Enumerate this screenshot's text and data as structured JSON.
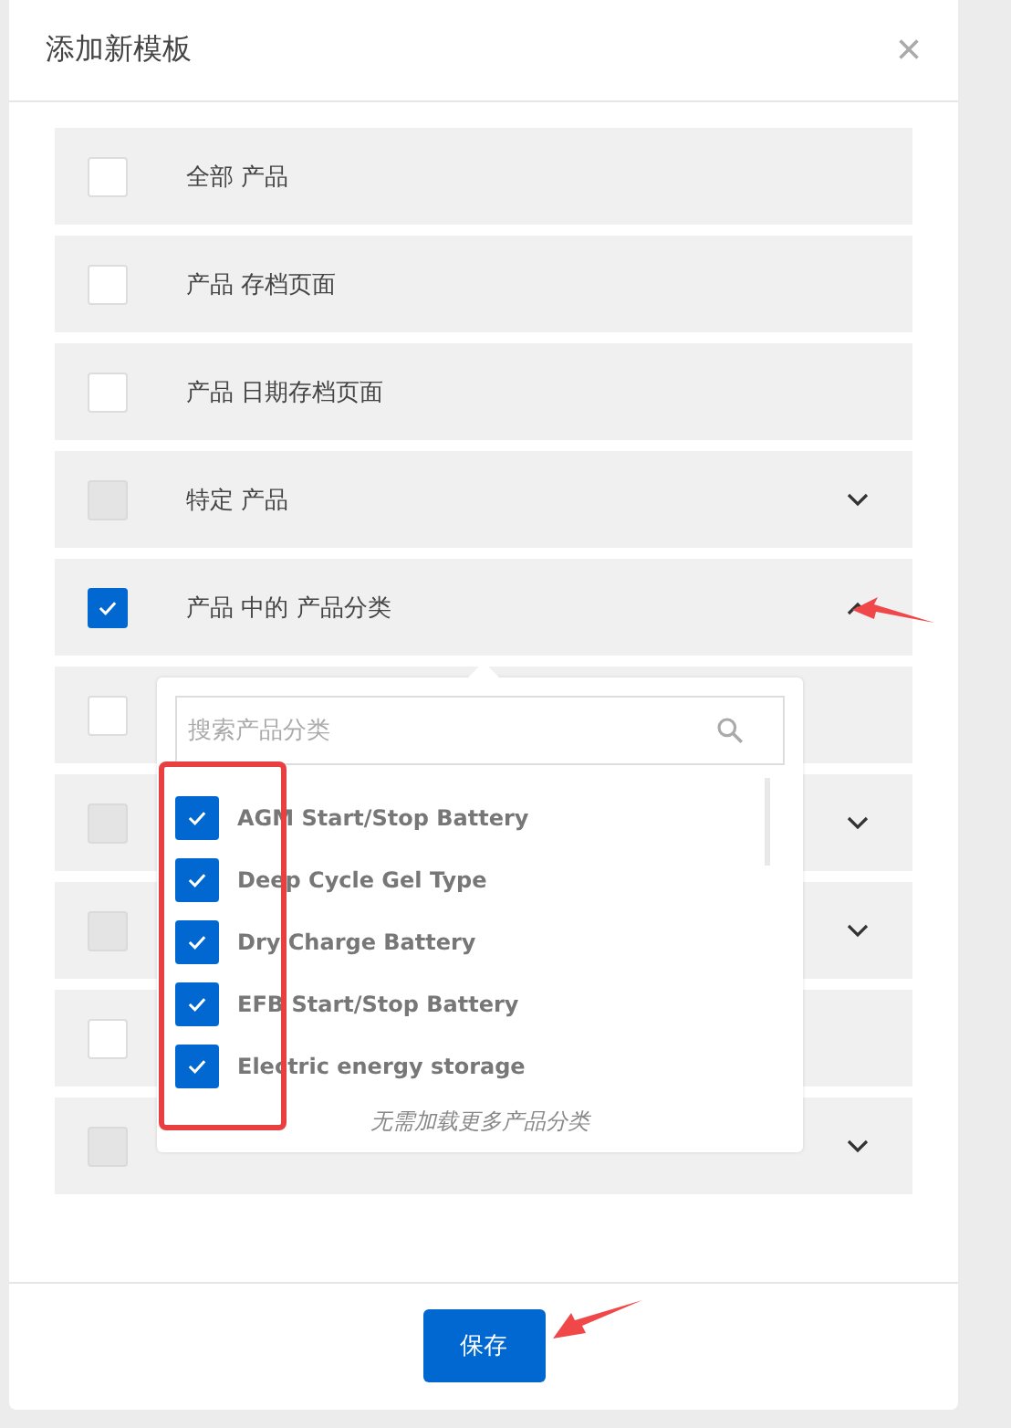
{
  "dialog": {
    "title": "添加新模板",
    "close": "×"
  },
  "options": [
    {
      "label": "全部 产品",
      "checked": false,
      "disabled": false
    },
    {
      "label": "产品 存档页面",
      "checked": false,
      "disabled": false
    },
    {
      "label": "产品 日期存档页面",
      "checked": false,
      "disabled": false
    },
    {
      "label": "特定 产品",
      "checked": false,
      "disabled": true,
      "expandable": true,
      "expanded": false
    },
    {
      "label": "产品 中的 产品分类",
      "checked": true,
      "disabled": false,
      "expandable": true,
      "expanded": true
    },
    {
      "checked": false,
      "disabled": false
    },
    {
      "checked": false,
      "disabled": true,
      "expandable": true,
      "expanded": false
    },
    {
      "checked": false,
      "disabled": true,
      "expandable": true,
      "expanded": false
    },
    {
      "checked": false,
      "disabled": false
    },
    {
      "checked": false,
      "disabled": true,
      "expandable": true,
      "expanded": false
    }
  ],
  "dropdown": {
    "search": {
      "placeholder": "搜索产品分类"
    },
    "items": [
      {
        "label": "AGM Start/Stop Battery",
        "checked": true
      },
      {
        "label": "Deep Cycle Gel Type",
        "checked": true
      },
      {
        "label": "Dry Charge Battery",
        "checked": true
      },
      {
        "label": "EFB Start/Stop Battery",
        "checked": true
      },
      {
        "label": "Electric energy storage",
        "checked": true
      }
    ],
    "footer": "无需加载更多产品分类"
  },
  "buttons": [
    "保存"
  ]
}
